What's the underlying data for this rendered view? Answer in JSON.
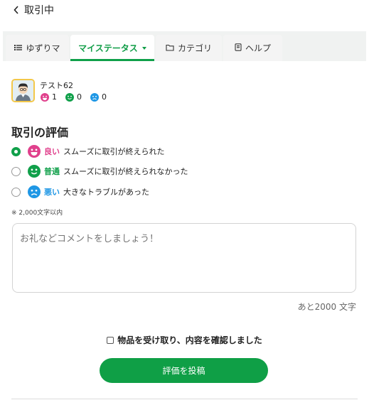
{
  "header": {
    "back_label": "取引中"
  },
  "tabs": [
    {
      "label": "ゆずりマ"
    },
    {
      "label": "マイステータス"
    },
    {
      "label": "カテゴリ"
    },
    {
      "label": "ヘルプ"
    }
  ],
  "user": {
    "name": "テスト62",
    "good": "1",
    "normal": "0",
    "bad": "0"
  },
  "rating": {
    "title": "取引の評価",
    "options": [
      {
        "label": "良い",
        "text": "スムーズに取引が終えられた",
        "color": "#e0408c"
      },
      {
        "label": "普通",
        "text": "スムーズに取引が終えられなかった",
        "color": "#10a04a"
      },
      {
        "label": "悪い",
        "text": "大きなトラブルがあった",
        "color": "#1f97e5"
      }
    ],
    "selected_index": 0
  },
  "comment": {
    "note": "※ 2,000文字以内",
    "placeholder": "お礼などコメントをしましょう！",
    "remaining": "あと2000 文字"
  },
  "confirm_label": "物品を受け取り、内容を確認しました",
  "submit_label": "評価を投稿",
  "colors": {
    "accent": "#10a04a",
    "good": "#e0408c",
    "normal": "#10a04a",
    "bad": "#1f97e5"
  }
}
